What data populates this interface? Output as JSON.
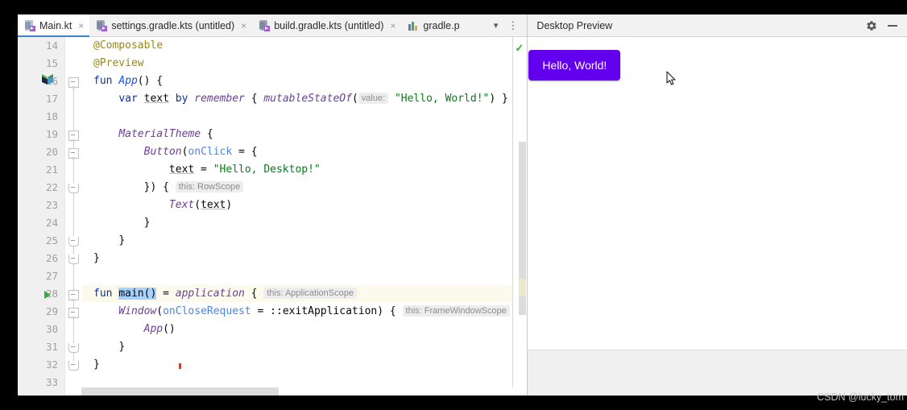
{
  "window": {
    "tabs": [
      {
        "label": "Main.kt",
        "icon": "kotlin-file-icon",
        "active": true,
        "closable": true
      },
      {
        "label": "settings.gradle.kts (untitled)",
        "icon": "gradle-kts-file-icon",
        "active": false,
        "closable": true
      },
      {
        "label": "build.gradle.kts (untitled)",
        "icon": "gradle-kts-file-icon",
        "active": false,
        "closable": true
      },
      {
        "label": "gradle.p",
        "icon": "gradle-properties-file-icon",
        "active": false,
        "closable": false
      }
    ],
    "tab_overflow_icon": "chevron-down-icon",
    "tab_menu_icon": "kebab-menu-icon",
    "close_glyph": "×"
  },
  "editor": {
    "first_line": 14,
    "highlighted_line": 28,
    "run_marker_line": 28,
    "compose_preview_marker_line": 16,
    "inspection_status": "ok-check",
    "lines": [
      {
        "n": 14,
        "indent": 1,
        "tokens": [
          {
            "t": "@Composable",
            "c": "anno"
          }
        ]
      },
      {
        "n": 15,
        "indent": 1,
        "tokens": [
          {
            "t": "@Preview",
            "c": "anno"
          }
        ]
      },
      {
        "n": 16,
        "indent": 1,
        "tokens": [
          {
            "t": "fun ",
            "c": "kw"
          },
          {
            "t": "App",
            "c": "fn"
          },
          {
            "t": "() {",
            "c": "plain"
          }
        ]
      },
      {
        "n": 17,
        "indent": 2,
        "tokens": [
          {
            "t": "var ",
            "c": "kw"
          },
          {
            "t": "text",
            "c": "local"
          },
          {
            "t": " by ",
            "c": "kw"
          },
          {
            "t": "remember",
            "c": "fnp"
          },
          {
            "t": " { ",
            "c": "plain"
          },
          {
            "t": "mutableStateOf",
            "c": "fnp"
          },
          {
            "t": "(",
            "c": "plain"
          },
          {
            "t": "value:",
            "c": "hint"
          },
          {
            "t": " ",
            "c": "plain"
          },
          {
            "t": "\"Hello, World!\"",
            "c": "str"
          },
          {
            "t": ") }",
            "c": "plain"
          }
        ]
      },
      {
        "n": 18,
        "indent": 0,
        "tokens": []
      },
      {
        "n": 19,
        "indent": 2,
        "tokens": [
          {
            "t": "MaterialTheme",
            "c": "fnp"
          },
          {
            "t": " {",
            "c": "plain"
          }
        ]
      },
      {
        "n": 20,
        "indent": 3,
        "tokens": [
          {
            "t": "Button",
            "c": "fnp"
          },
          {
            "t": "(",
            "c": "plain"
          },
          {
            "t": "onClick",
            "c": "param"
          },
          {
            "t": " = {",
            "c": "plain"
          }
        ]
      },
      {
        "n": 21,
        "indent": 4,
        "tokens": [
          {
            "t": "text",
            "c": "local"
          },
          {
            "t": " = ",
            "c": "plain"
          },
          {
            "t": "\"Hello, Desktop!\"",
            "c": "str"
          }
        ]
      },
      {
        "n": 22,
        "indent": 3,
        "tokens": [
          {
            "t": "}) { ",
            "c": "plain"
          },
          {
            "t": "this: RowScope",
            "c": "hint"
          }
        ]
      },
      {
        "n": 23,
        "indent": 4,
        "tokens": [
          {
            "t": "Text",
            "c": "fnp"
          },
          {
            "t": "(",
            "c": "plain"
          },
          {
            "t": "text",
            "c": "local"
          },
          {
            "t": ")",
            "c": "plain"
          }
        ]
      },
      {
        "n": 24,
        "indent": 3,
        "tokens": [
          {
            "t": "}",
            "c": "plain"
          }
        ]
      },
      {
        "n": 25,
        "indent": 2,
        "tokens": [
          {
            "t": "}",
            "c": "plain"
          }
        ]
      },
      {
        "n": 26,
        "indent": 1,
        "tokens": [
          {
            "t": "}",
            "c": "plain"
          }
        ]
      },
      {
        "n": 27,
        "indent": 0,
        "tokens": []
      },
      {
        "n": 28,
        "indent": 1,
        "tokens": [
          {
            "t": "fun ",
            "c": "kw"
          },
          {
            "t": "main()",
            "c": "sel"
          },
          {
            "t": " = ",
            "c": "plain"
          },
          {
            "t": "application",
            "c": "fnp"
          },
          {
            "t": " { ",
            "c": "plain"
          },
          {
            "t": "this: ApplicationScope",
            "c": "hint"
          }
        ]
      },
      {
        "n": 29,
        "indent": 2,
        "tokens": [
          {
            "t": "Window",
            "c": "fnp"
          },
          {
            "t": "(",
            "c": "plain"
          },
          {
            "t": "onCloseRequest",
            "c": "param"
          },
          {
            "t": " = ::exitApplication) { ",
            "c": "plain"
          },
          {
            "t": "this: FrameWindowScope",
            "c": "hint"
          }
        ]
      },
      {
        "n": 30,
        "indent": 3,
        "tokens": [
          {
            "t": "App",
            "c": "fnp"
          },
          {
            "t": "()",
            "c": "plain"
          }
        ]
      },
      {
        "n": 31,
        "indent": 2,
        "tokens": [
          {
            "t": "}",
            "c": "plain"
          }
        ]
      },
      {
        "n": 32,
        "indent": 1,
        "tokens": [
          {
            "t": "}",
            "c": "plain"
          }
        ]
      },
      {
        "n": 33,
        "indent": 0,
        "tokens": []
      }
    ]
  },
  "preview": {
    "title": "Desktop Preview",
    "settings_icon": "gear-icon",
    "minimize_icon": "minimize-icon",
    "button_label": "Hello, World!",
    "button_color": "#6200ee",
    "cursor_icon": "mouse-pointer-icon"
  },
  "watermark": "CSDN @lucky_tom"
}
